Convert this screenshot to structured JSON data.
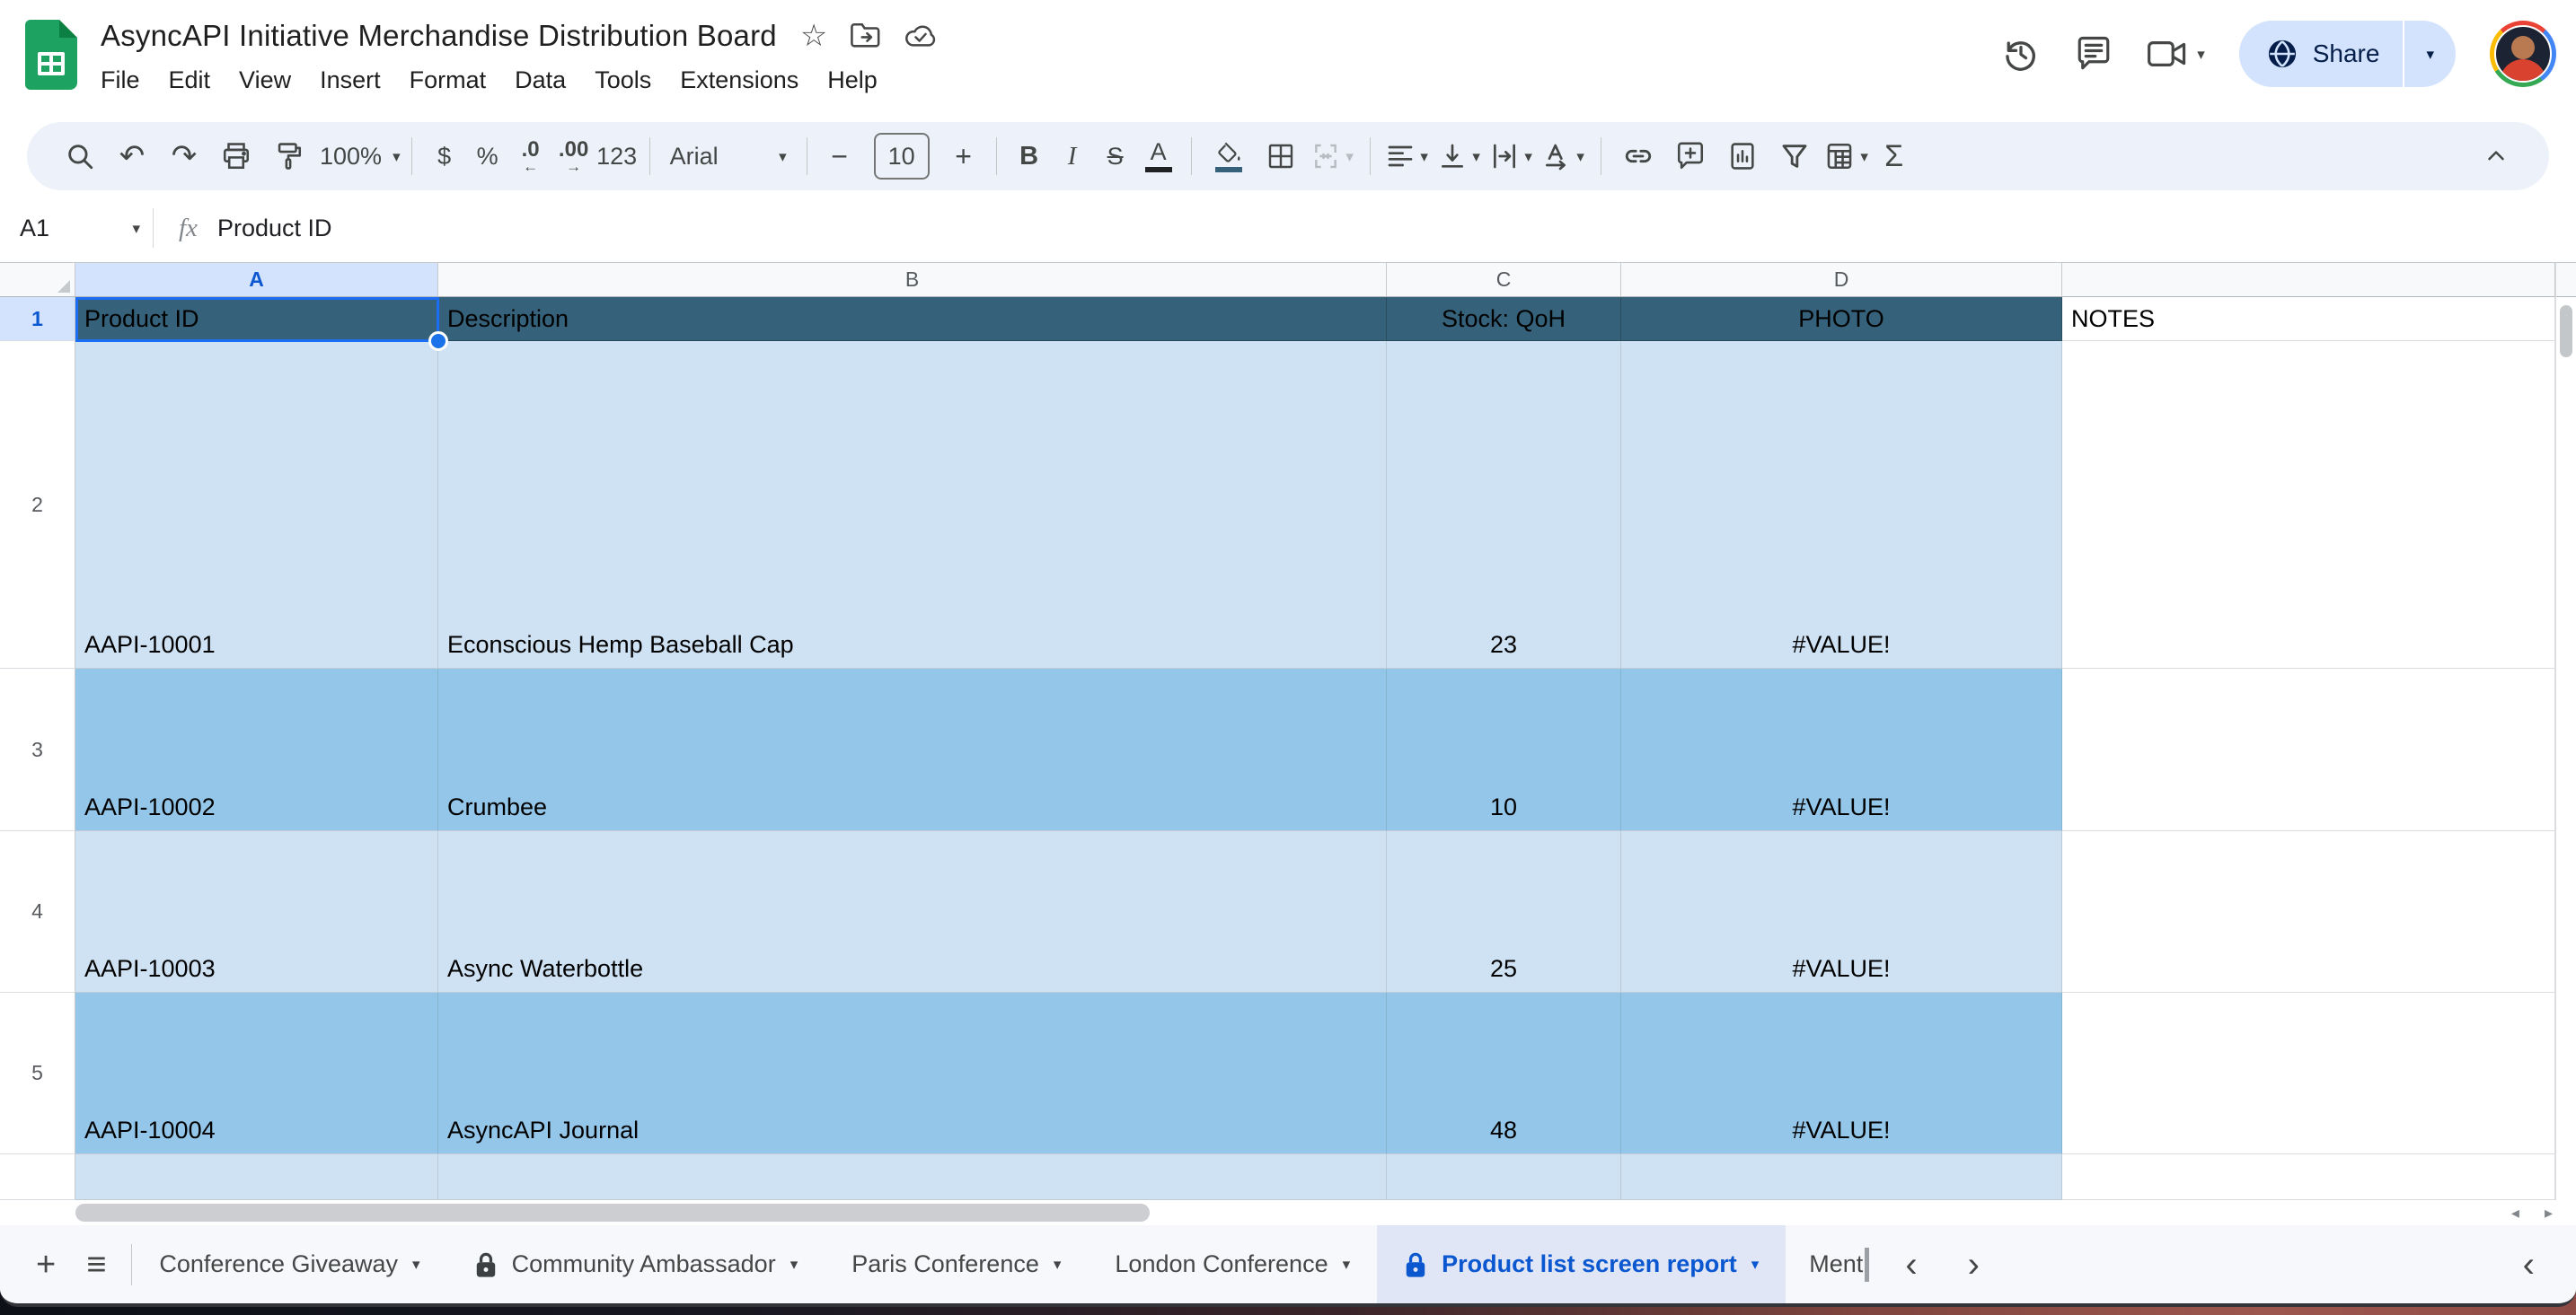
{
  "window": {
    "title": "AsyncAPI Initiative Merchandise Distribution Board"
  },
  "menus": [
    "File",
    "Edit",
    "View",
    "Insert",
    "Format",
    "Data",
    "Tools",
    "Extensions",
    "Help"
  ],
  "topbar": {
    "share_label": "Share"
  },
  "toolbar": {
    "zoom": "100%",
    "currency": "$",
    "percent": "%",
    "dec_decrease": ".0",
    "dec_increase": ".00",
    "format_number": "123",
    "font_name": "Arial",
    "font_size": "10",
    "bold": "B",
    "italic": "I",
    "strike": "S",
    "text_color": "A",
    "sigma": "Σ",
    "minus": "−",
    "plus": "+"
  },
  "glyphs": {
    "undo": "↶",
    "redo": "↷",
    "caret_down": "▾",
    "star": "☆",
    "add_sheet": "+",
    "all_sheets": "≡",
    "chev_left": "‹",
    "chev_right": "›",
    "scroll_left": "◂",
    "scroll_right": "▸"
  },
  "formula_bar": {
    "name_box": "A1",
    "fx": "fx",
    "formula": "Product ID"
  },
  "grid": {
    "column_letters": [
      "A",
      "B",
      "C",
      "D"
    ],
    "row_numbers": [
      "1",
      "2",
      "3",
      "4",
      "5"
    ],
    "header_row": {
      "product_id": "Product ID",
      "description": "Description",
      "stock": "Stock: QoH",
      "photo": "PHOTO",
      "notes": "NOTES"
    },
    "rows": [
      {
        "id": "AAPI-10001",
        "description": "Econscious Hemp Baseball Cap",
        "stock": "23",
        "photo": "#VALUE!"
      },
      {
        "id": "AAPI-10002",
        "description": "Crumbee",
        "stock": "10",
        "photo": "#VALUE!"
      },
      {
        "id": "AAPI-10003",
        "description": "Async Waterbottle",
        "stock": "25",
        "photo": "#VALUE!"
      },
      {
        "id": "AAPI-10004",
        "description": "AsyncAPI Journal",
        "stock": "48",
        "photo": "#VALUE!"
      }
    ]
  },
  "tabs": [
    {
      "label": "Conference Giveaway"
    },
    {
      "label": "Community Ambassador"
    },
    {
      "label": "Paris Conference"
    },
    {
      "label": "London Conference"
    },
    {
      "label": "Product list screen report"
    },
    {
      "label": "Ment"
    }
  ],
  "colors": {
    "header_fill": "#35627a",
    "band_light": "#cfe2f3",
    "band_medium": "#93c6e8",
    "selection_blue": "#1a73e8",
    "active_tab_text": "#0b57d0",
    "active_tab_bg": "#e0e6f6",
    "share_bg": "#d3e3fd"
  }
}
